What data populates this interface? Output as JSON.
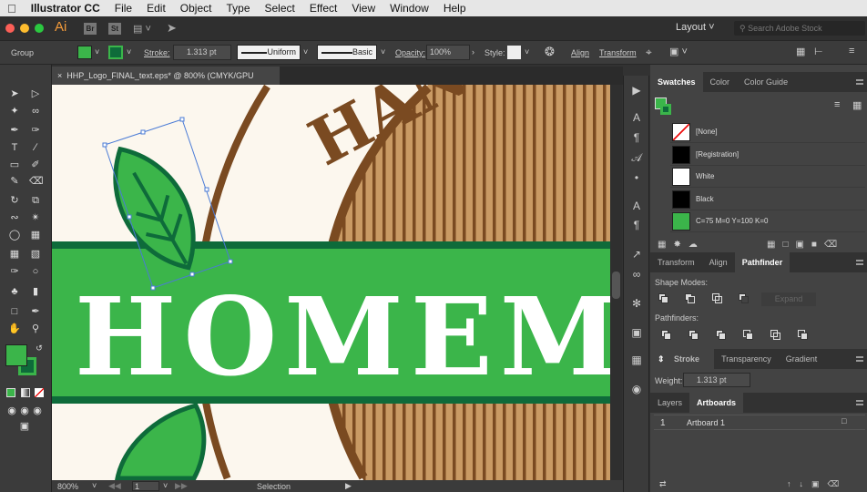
{
  "menubar": {
    "app": "Illustrator CC",
    "items": [
      "File",
      "Edit",
      "Object",
      "Type",
      "Select",
      "Effect",
      "View",
      "Window",
      "Help"
    ]
  },
  "appbar": {
    "logo": "Ai",
    "bridge": "Br",
    "stock": "St",
    "workspace": "Layout",
    "search_placeholder": "Search Adobe Stock"
  },
  "control": {
    "selection": "Group",
    "stroke_label": "Stroke:",
    "stroke_value": "1.313 pt",
    "profile": "Uniform",
    "brush": "Basic",
    "opacity_label": "Opacity:",
    "opacity_value": "100%",
    "style_label": "Style:",
    "align": "Align",
    "transform": "Transform"
  },
  "colors": {
    "fill": "#3bb54a",
    "stroke": "#0e6b3a",
    "brown": "#7a4a21",
    "tan": "#c99a64",
    "cream": "#fcf7ee",
    "band": "#3bb54a",
    "band_dark": "#0e6b3a"
  },
  "document": {
    "tab": "HHP_Logo_FINAL_text.eps* @ 800% (CMYK/GPU Preview)",
    "art_text": "HOMEM",
    "arc_text": "HAN"
  },
  "status": {
    "zoom": "800%",
    "page": "1",
    "tool": "Selection"
  },
  "swatches": {
    "tabs": [
      "Swatches",
      "Color",
      "Color Guide"
    ],
    "items": [
      {
        "name": "[None]",
        "color": "#ffffff"
      },
      {
        "name": "[Registration]",
        "color": "#000000"
      },
      {
        "name": "White",
        "color": "#ffffff"
      },
      {
        "name": "Black",
        "color": "#000000"
      },
      {
        "name": "C=75 M=0 Y=100 K=0",
        "color": "#3bb54a"
      }
    ]
  },
  "pathfinder": {
    "tabs": [
      "Transform",
      "Align",
      "Pathfinder"
    ],
    "shape_modes": "Shape Modes:",
    "expand": "Expand",
    "pathfinders": "Pathfinders:"
  },
  "stroke_panel": {
    "tabs": [
      "Stroke",
      "Transparency",
      "Gradient"
    ],
    "weight_label": "Weight:",
    "weight_value": "1.313 pt"
  },
  "artboards": {
    "tabs": [
      "Layers",
      "Artboards"
    ],
    "rows": [
      {
        "num": "1",
        "name": "Artboard 1"
      }
    ]
  }
}
